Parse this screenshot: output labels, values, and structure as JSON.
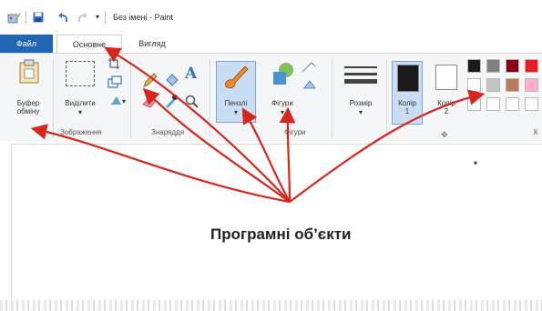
{
  "window": {
    "title": "Без імені - Paint"
  },
  "tabs": {
    "file": "Файл",
    "home": "Основне",
    "view": "Вигляд"
  },
  "ribbon": {
    "clipboard_label": "Буфер\nобміну",
    "select_label": "Виділити",
    "group_image": "Зображення",
    "group_tools": "Знаряддя",
    "brushes_label": "Пензлі",
    "shapes_label": "Фігури",
    "group_shapes": "Фігури",
    "size_label": "Розмір",
    "color1_label": "Колір\n1",
    "color2_label": "Колір\n2",
    "group_colors_cut": "К"
  },
  "caption": "Програмні об’єкти",
  "colors": {
    "accent_file_tab": "#1e66b3",
    "arrow_red": "#d9261c",
    "color1": "#1a1a1a",
    "color2": "#ffffff",
    "palette_row1": [
      "#1a1a1a",
      "#7f7f7f",
      "#880015",
      "#ed1c24"
    ],
    "palette_row2": [
      "#ffffff",
      "#c3c3c3",
      "#b97a57",
      "#ffaec9"
    ],
    "palette_row3": [
      "#ffffff",
      "#ffffff",
      "#ffffff",
      "#ffffff"
    ]
  },
  "icons": [
    "paint-app-icon",
    "save-icon",
    "undo-icon",
    "redo-icon",
    "clipboard-icon",
    "select-rect-icon",
    "crop-icon",
    "resize-icon",
    "rotate-icon",
    "pencil-icon",
    "fill-icon",
    "text-icon",
    "eraser-icon",
    "color-picker-icon",
    "magnifier-icon",
    "brush-icon",
    "shapes-icon",
    "size-lines-icon"
  ]
}
